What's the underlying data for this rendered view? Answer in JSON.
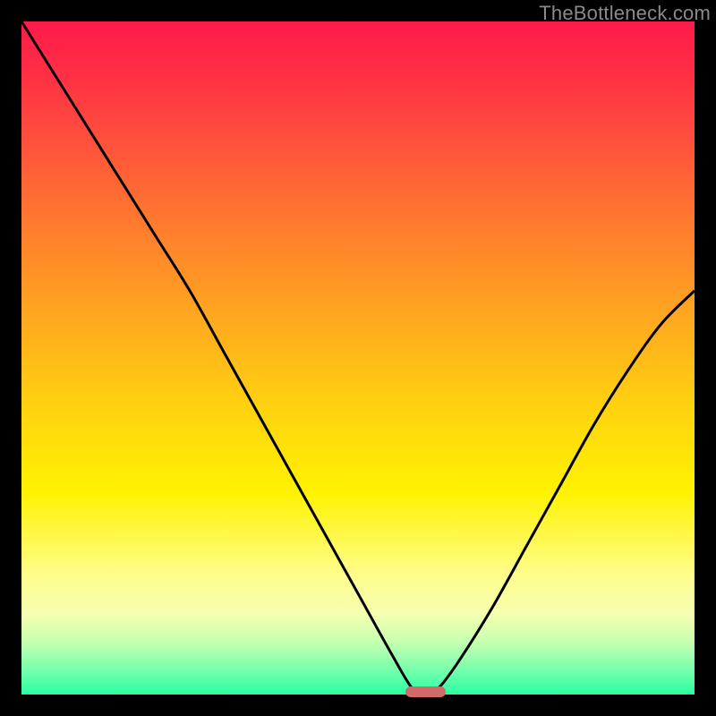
{
  "watermark": "TheBottleneck.com",
  "colors": {
    "frame": "#000000",
    "curve": "#000000",
    "marker": "#d36a6a"
  },
  "chart_data": {
    "type": "line",
    "title": "",
    "xlabel": "",
    "ylabel": "",
    "xlim": [
      0,
      100
    ],
    "ylim": [
      0,
      100
    ],
    "grid": false,
    "legend": false,
    "series": [
      {
        "name": "bottleneck-curve",
        "x": [
          0,
          5,
          10,
          15,
          20,
          25,
          30,
          35,
          40,
          45,
          50,
          55,
          58,
          60,
          62,
          65,
          70,
          75,
          80,
          85,
          90,
          95,
          100
        ],
        "y": [
          100,
          92,
          84,
          76,
          68,
          60,
          51,
          42,
          33,
          24,
          15,
          6,
          1,
          0,
          1,
          5,
          13,
          22,
          31,
          40,
          48,
          55,
          60
        ]
      }
    ],
    "marker": {
      "x_center": 60,
      "y": 0,
      "width_pct": 6
    },
    "background_gradient_stops": [
      {
        "pos": 0,
        "color": "#ff1a4b"
      },
      {
        "pos": 6,
        "color": "#ff2a45"
      },
      {
        "pos": 16,
        "color": "#ff4a3e"
      },
      {
        "pos": 30,
        "color": "#ff7a2e"
      },
      {
        "pos": 44,
        "color": "#ffa81f"
      },
      {
        "pos": 58,
        "color": "#ffd40f"
      },
      {
        "pos": 70,
        "color": "#fff200"
      },
      {
        "pos": 82,
        "color": "#fffd8a"
      },
      {
        "pos": 88,
        "color": "#f6ffb0"
      },
      {
        "pos": 92,
        "color": "#c9ffb0"
      },
      {
        "pos": 96,
        "color": "#7dffad"
      },
      {
        "pos": 100,
        "color": "#2affa3"
      }
    ]
  }
}
